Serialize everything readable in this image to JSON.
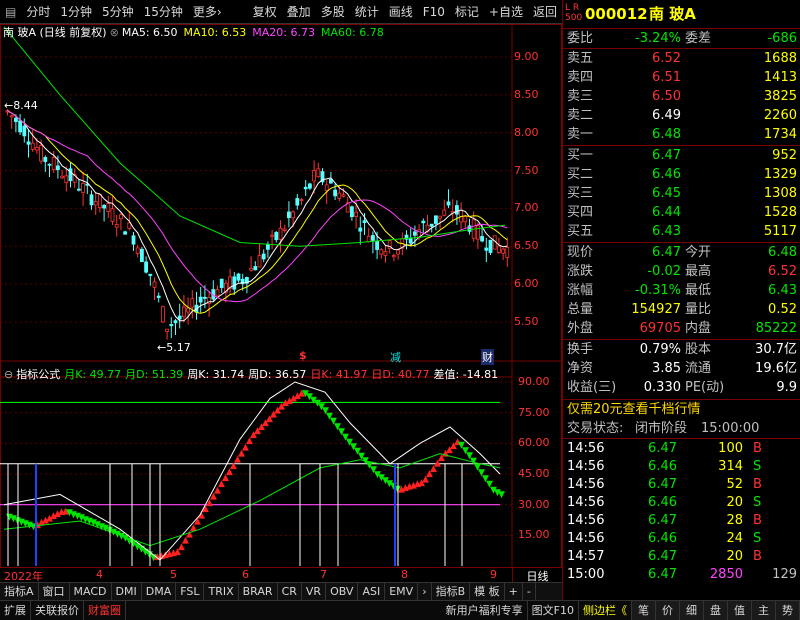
{
  "toolbar": {
    "left_items": [
      "分时",
      "1分钟",
      "5分钟",
      "15分钟",
      "更多›"
    ],
    "right_items": [
      "复权",
      "叠加",
      "多股",
      "统计",
      "画线",
      "F10",
      "标记",
      "+自选",
      "返回"
    ]
  },
  "main_chart": {
    "title": "南 玻A (日线 前复权)",
    "ma5": "MA5: 6.50",
    "ma10": "MA10: 6.53",
    "ma20": "MA20: 6.73",
    "ma60": "MA60: 6.78",
    "price_ticks": [
      "9.00",
      "8.50",
      "8.00",
      "7.50",
      "7.00",
      "6.50",
      "6.00",
      "5.50"
    ],
    "high_label": "8.44",
    "low_label": "5.17",
    "event_markers": [
      "$",
      "减",
      "财"
    ]
  },
  "indicator": {
    "name": "指标公式",
    "values": [
      {
        "label": "月K: 49.77",
        "color": "#00e600"
      },
      {
        "label": "月D: 51.39",
        "color": "#00e600"
      },
      {
        "label": "周K: 31.74",
        "color": "#ffffff"
      },
      {
        "label": "周D: 36.57",
        "color": "#ffffff"
      },
      {
        "label": "日K: 41.97",
        "color": "#ff3232"
      },
      {
        "label": "日D: 40.77",
        "color": "#ff3232"
      },
      {
        "label": "差值: -14.81",
        "color": "#ffffff"
      }
    ],
    "ticks": [
      "90.00",
      "75.00",
      "60.00",
      "45.00",
      "30.00",
      "15.00"
    ]
  },
  "xaxis": {
    "labels": [
      "2022年",
      "4",
      "5",
      "6",
      "7",
      "8",
      "9"
    ],
    "period_button": "日线"
  },
  "indicator_tabs": [
    "指标A",
    "窗口",
    "MACD",
    "DMI",
    "DMA",
    "FSL",
    "TRIX",
    "BRAR",
    "CR",
    "VR",
    "OBV",
    "ASI",
    "EMV",
    "›",
    "指标B",
    "模 板",
    "+",
    "-"
  ],
  "status_left": [
    "扩展",
    "关联报价",
    "财富圈"
  ],
  "status_right": [
    "新用户福利专享",
    "图文F10",
    "侧边栏《"
  ],
  "side_tabs": [
    "笔",
    "价",
    "细",
    "盘",
    "值",
    "主",
    "势"
  ],
  "quote": {
    "code": "000012",
    "name": "南 玻A",
    "badge_top": "L  R",
    "badge_bottom": "500",
    "weibi_label": "委比",
    "weibi": "-3.24%",
    "weicha_label": "委差",
    "weicha": "-686",
    "asks": [
      {
        "label": "卖五",
        "price": "6.52",
        "vol": "1688"
      },
      {
        "label": "卖四",
        "price": "6.51",
        "vol": "1413"
      },
      {
        "label": "卖三",
        "price": "6.50",
        "vol": "3825"
      },
      {
        "label": "卖二",
        "price": "6.49",
        "vol": "2260"
      },
      {
        "label": "卖一",
        "price": "6.48",
        "vol": "1734"
      }
    ],
    "bids": [
      {
        "label": "买一",
        "price": "6.47",
        "vol": "952"
      },
      {
        "label": "买二",
        "price": "6.46",
        "vol": "1329"
      },
      {
        "label": "买三",
        "price": "6.45",
        "vol": "1308"
      },
      {
        "label": "买四",
        "price": "6.44",
        "vol": "1528"
      },
      {
        "label": "买五",
        "price": "6.43",
        "vol": "5117"
      }
    ],
    "stats": [
      {
        "l1": "现价",
        "v1": "6.47",
        "l2": "今开",
        "v2": "6.48"
      },
      {
        "l1": "涨跌",
        "v1": "-0.02",
        "l2": "最高",
        "v2": "6.52"
      },
      {
        "l1": "涨幅",
        "v1": "-0.31%",
        "l2": "最低",
        "v2": "6.43"
      },
      {
        "l1": "总量",
        "v1": "154927",
        "l2": "量比",
        "v2": "0.52"
      },
      {
        "l1": "外盘",
        "v1": "69705",
        "l2": "内盘",
        "v2": "85222"
      }
    ],
    "stats2": [
      {
        "l1": "换手",
        "v1": "0.79%",
        "l2": "股本",
        "v2": "30.7亿"
      },
      {
        "l1": "净资",
        "v1": "3.85",
        "l2": "流通",
        "v2": "19.6亿"
      },
      {
        "l1": "收益(三)",
        "v1": "0.330",
        "l2": "PE(动)",
        "v2": "9.9"
      }
    ],
    "promo": "仅需20元查看千档行情",
    "trade_state_label": "交易状态:",
    "trade_state": "闭市阶段",
    "trade_state_time": "15:00:00",
    "trades": [
      {
        "time": "14:56",
        "price": "6.47",
        "vol": "100",
        "bs": "B"
      },
      {
        "time": "14:56",
        "price": "6.46",
        "vol": "314",
        "bs": "S"
      },
      {
        "time": "14:56",
        "price": "6.47",
        "vol": "52",
        "bs": "B"
      },
      {
        "time": "14:56",
        "price": "6.46",
        "vol": "20",
        "bs": "S"
      },
      {
        "time": "14:56",
        "price": "6.47",
        "vol": "28",
        "bs": "B"
      },
      {
        "time": "14:56",
        "price": "6.46",
        "vol": "24",
        "bs": "S"
      },
      {
        "time": "14:57",
        "price": "6.47",
        "vol": "20",
        "bs": "B"
      },
      {
        "time": "15:00",
        "price": "6.47",
        "vol": "2850",
        "bs": "",
        "extra": "129"
      }
    ]
  },
  "colors": {
    "up": "#ff3232",
    "down": "#00e600",
    "frame": "#7a0000",
    "ma5": "#ffffff",
    "ma10": "#ffff00",
    "ma20": "#ff44ff",
    "ma60": "#00e600"
  }
}
